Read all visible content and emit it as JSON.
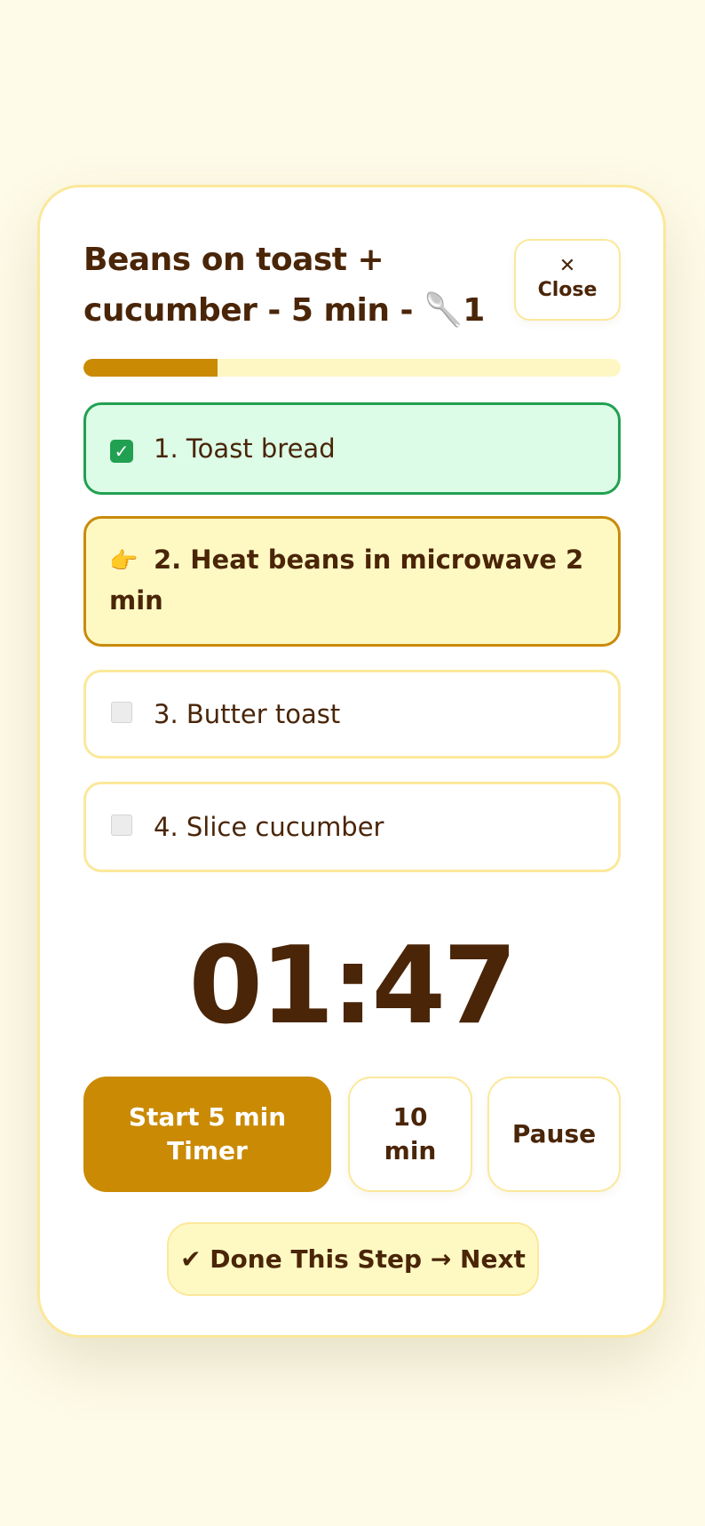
{
  "recipe": {
    "title": "Beans on toast + cucumber - 5 min - 🥄1"
  },
  "close_button": {
    "icon": "close-icon",
    "glyph": "✕",
    "label": "Close"
  },
  "progress": {
    "fraction": 0.25,
    "fill_color": "#CA8A04",
    "track_color": "#FEF7C3"
  },
  "steps": [
    {
      "status": "done",
      "icon": "check-icon",
      "label": "1. Toast bread"
    },
    {
      "status": "current",
      "icon": "pointing-hand-icon",
      "glyph": "👉",
      "label": "2. Heat beans in microwave 2 min"
    },
    {
      "status": "pending",
      "icon": "empty-checkbox-icon",
      "label": "3. Butter toast"
    },
    {
      "status": "pending",
      "icon": "empty-checkbox-icon",
      "label": "4. Slice cucumber"
    }
  ],
  "timer": {
    "display": "01:47"
  },
  "controls": {
    "start_label": "Start 5 min Timer",
    "ten_label": "10 min",
    "pause_label": "Pause",
    "next_label": "✔ Done This Step → Next"
  },
  "colors": {
    "accent": "#CA8A04",
    "text": "#4A2508",
    "done_bg": "#DCFCE7",
    "done_border": "#22A052",
    "current_bg": "#FEF9C3",
    "border": "#FBE89A",
    "page_bg": "#FEFBE8"
  }
}
